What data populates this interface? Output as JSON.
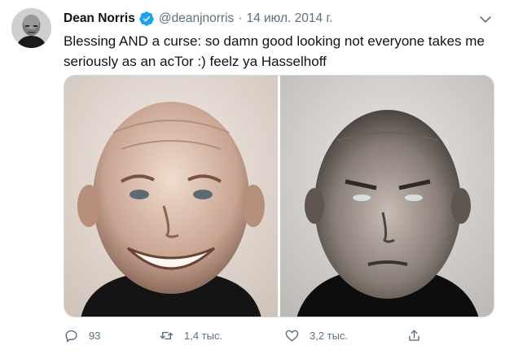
{
  "tweet": {
    "author_name": "Dean Norris",
    "handle": "@deanjnorris",
    "separator": "·",
    "date": "14 июл. 2014 г.",
    "text_line1": "Blessing AND a curse: so damn good looking not everyone takes me",
    "text_line2": "seriously as an acTor :) feelz ya Hasselhoff"
  },
  "actions": {
    "reply_count": "93",
    "retweet_count": "1,4 тыс.",
    "like_count": "3,2 тыс."
  },
  "icons": {
    "verified": "verified-badge-icon",
    "more": "chevron-down-icon",
    "reply": "reply-icon",
    "retweet": "retweet-icon",
    "like": "heart-icon",
    "share": "share-icon"
  },
  "colors": {
    "verified": "#1da1f2",
    "secondary_text": "#5b7083"
  }
}
